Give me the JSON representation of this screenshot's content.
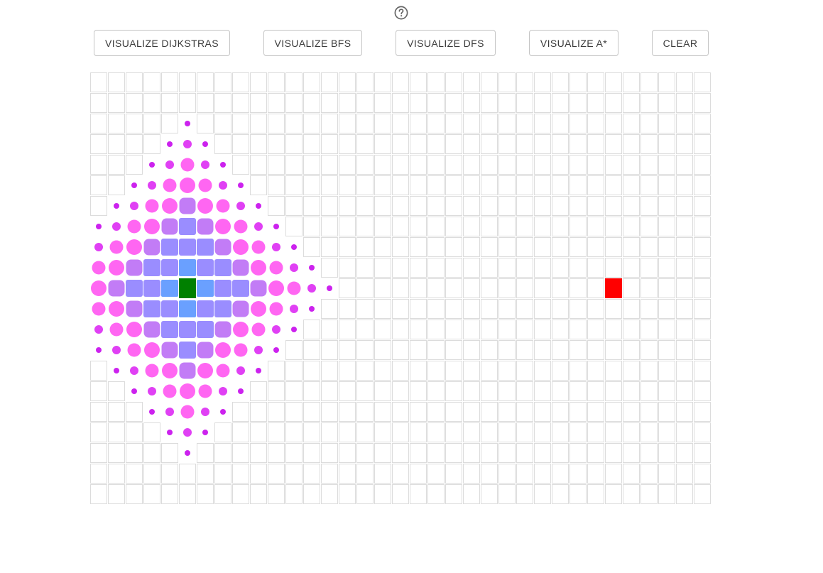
{
  "app": {
    "help_icon": "help-circle-icon"
  },
  "toolbar": {
    "buttons": [
      {
        "id": "dijkstra",
        "label": "VISUALIZE DIJKSTRAS"
      },
      {
        "id": "bfs",
        "label": "VISUALIZE BFS"
      },
      {
        "id": "dfs",
        "label": "VISUALIZE DFS"
      },
      {
        "id": "astar",
        "label": "VISUALIZE A*"
      },
      {
        "id": "clear",
        "label": "CLEAR"
      }
    ]
  },
  "grid": {
    "rows": 21,
    "cols": 35,
    "start": {
      "row": 10,
      "col": 5
    },
    "end": {
      "row": 10,
      "col": 29
    },
    "colors": {
      "start": "#008000",
      "end": "#ff0000",
      "visited_inner": "#6aa0ff",
      "visited_mid": "#9a8dff",
      "visited_outer": "#ff66f2",
      "visited_frontier": "#cc22ee",
      "cell_border": "#dcdcdc"
    },
    "visited_max_distance": 8
  }
}
